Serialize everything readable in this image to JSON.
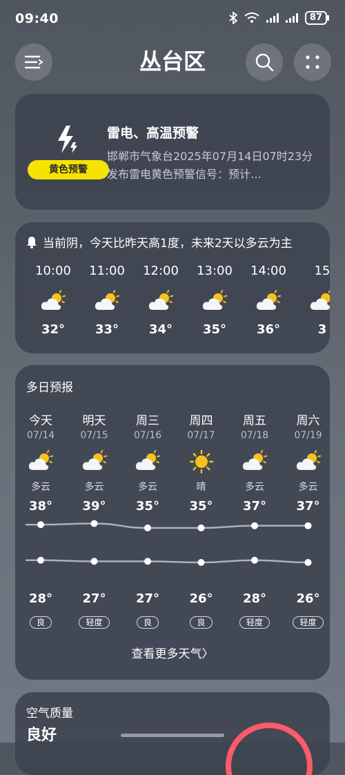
{
  "status_bar": {
    "time": "09:40",
    "battery": "87"
  },
  "header": {
    "title": "丛台区",
    "menu_icon": "menu-icon",
    "search_icon": "search-icon",
    "more_icon": "more-icon"
  },
  "alert": {
    "badge": "黄色预警",
    "title": "雷电、高温预警",
    "body": "邯郸市气象台2025年07月14日07时23分发布雷电黄色预警信号：预计…",
    "icon": "lightning-icon"
  },
  "hourly": {
    "summary": "当前阴，今天比昨天高1度，未来2天以多云为主",
    "hours": [
      {
        "time": "10:00",
        "temp": "32°",
        "icon": "partly-cloudy-icon"
      },
      {
        "time": "11:00",
        "temp": "33°",
        "icon": "partly-cloudy-icon"
      },
      {
        "time": "12:00",
        "temp": "34°",
        "icon": "partly-cloudy-icon"
      },
      {
        "time": "13:00",
        "temp": "35°",
        "icon": "partly-cloudy-icon"
      },
      {
        "time": "14:00",
        "temp": "36°",
        "icon": "partly-cloudy-icon"
      },
      {
        "time": "15",
        "temp": "3",
        "icon": "partly-cloudy-icon"
      }
    ]
  },
  "daily": {
    "title": "多日预报",
    "days": [
      {
        "name": "今天",
        "date": "07/14",
        "cond": "多云",
        "high": "38°",
        "low": "28°",
        "aqi": "良",
        "icon": "partly-cloudy-icon",
        "high_val": 38,
        "low_val": 28
      },
      {
        "name": "明天",
        "date": "07/15",
        "cond": "多云",
        "high": "39°",
        "low": "27°",
        "aqi": "轻度",
        "icon": "partly-cloudy-icon",
        "high_val": 39,
        "low_val": 27
      },
      {
        "name": "周三",
        "date": "07/16",
        "cond": "多云",
        "high": "35°",
        "low": "27°",
        "aqi": "良",
        "icon": "partly-cloudy-icon",
        "high_val": 35,
        "low_val": 27
      },
      {
        "name": "周四",
        "date": "07/17",
        "cond": "晴",
        "high": "35°",
        "low": "26°",
        "aqi": "良",
        "icon": "sunny-icon",
        "high_val": 35,
        "low_val": 26
      },
      {
        "name": "周五",
        "date": "07/18",
        "cond": "多云",
        "high": "37°",
        "low": "28°",
        "aqi": "轻度",
        "icon": "partly-cloudy-icon",
        "high_val": 37,
        "low_val": 28
      },
      {
        "name": "周六",
        "date": "07/19",
        "cond": "多云",
        "high": "37°",
        "low": "26°",
        "aqi": "轻度",
        "icon": "partly-cloudy-icon",
        "high_val": 37,
        "low_val": 26
      }
    ],
    "more_link": "查看更多天气〉"
  },
  "air_quality": {
    "title": "空气质量",
    "value": "良好"
  },
  "colors": {
    "alert_badge": "#f5e400",
    "sun": "#f7c21f",
    "card": "#3c424e",
    "aq_ring": "#ff5a6a"
  }
}
